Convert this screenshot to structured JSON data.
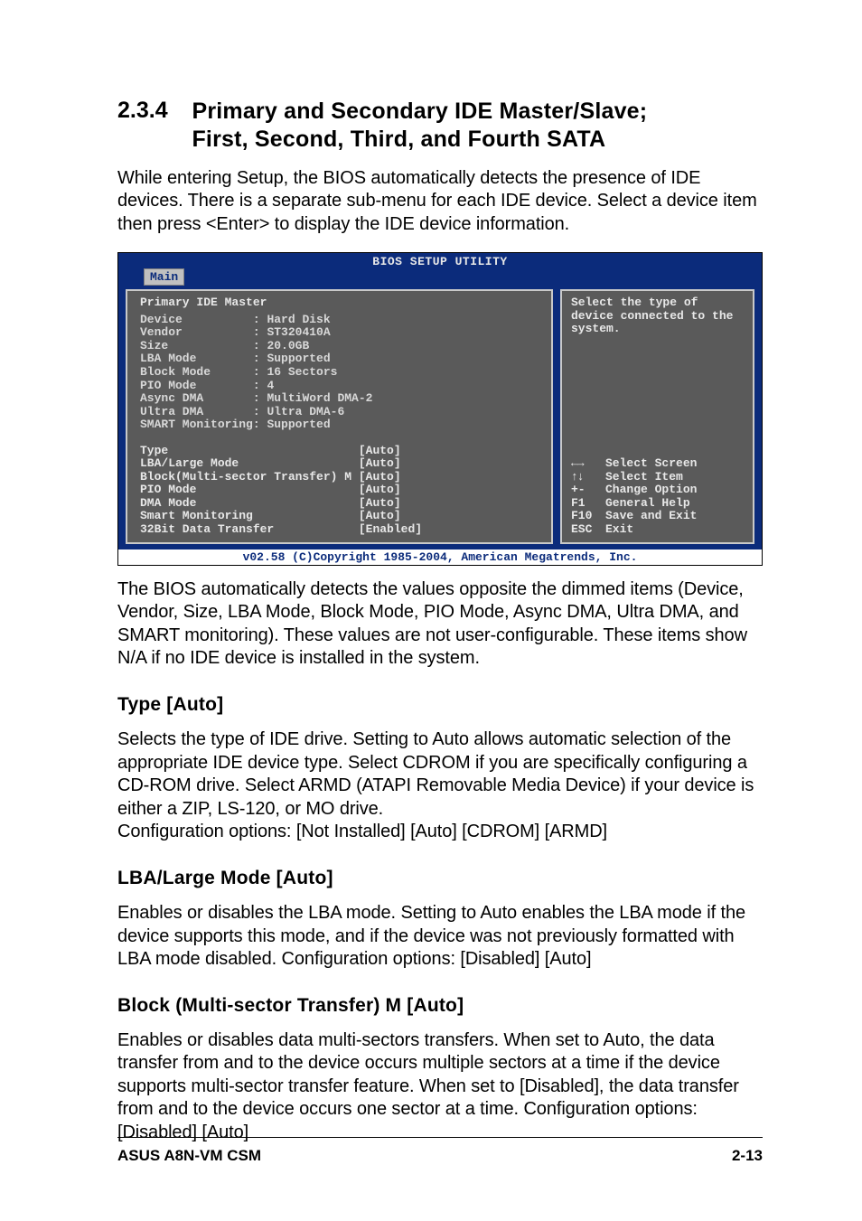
{
  "section": {
    "number": "2.3.4",
    "title_line1": "Primary and Secondary IDE Master/Slave;",
    "title_line2": "First, Second, Third, and Fourth SATA"
  },
  "intro": "While entering Setup, the BIOS automatically detects the presence of IDE devices. There is a separate sub-menu for each IDE device. Select a device item then press <Enter> to display the IDE device information.",
  "bios": {
    "header": "BIOS SETUP UTILITY",
    "tab": "Main",
    "panel_title": "Primary IDE Master",
    "info": [
      {
        "label": "Device",
        "value": "Hard Disk"
      },
      {
        "label": "Vendor",
        "value": "ST320410A"
      },
      {
        "label": "Size",
        "value": "20.0GB"
      },
      {
        "label": "LBA Mode",
        "value": "Supported"
      },
      {
        "label": "Block Mode",
        "value": "16 Sectors"
      },
      {
        "label": "PIO Mode",
        "value": "4"
      },
      {
        "label": "Async DMA",
        "value": "MultiWord DMA-2"
      },
      {
        "label": "Ultra DMA",
        "value": "Ultra DMA-6"
      },
      {
        "label": "SMART Monitoring",
        "value": "Supported"
      }
    ],
    "settings": [
      {
        "label": "Type",
        "value": "[Auto]"
      },
      {
        "label": "LBA/Large Mode",
        "value": "[Auto]"
      },
      {
        "label": "Block(Multi-sector Transfer) M",
        "value": "[Auto]"
      },
      {
        "label": "PIO Mode",
        "value": "[Auto]"
      },
      {
        "label": "DMA Mode",
        "value": "[Auto]"
      },
      {
        "label": "Smart Monitoring",
        "value": "[Auto]"
      },
      {
        "label": "32Bit Data Transfer",
        "value": "[Enabled]"
      }
    ],
    "help_text": "Select the type of device connected to the system.",
    "nav": [
      {
        "key": "←→",
        "label": "Select Screen"
      },
      {
        "key": "↑↓",
        "label": "Select Item"
      },
      {
        "key": "+-",
        "label": "Change Option"
      },
      {
        "key": "F1",
        "label": "General Help"
      },
      {
        "key": "F10",
        "label": "Save and Exit"
      },
      {
        "key": "ESC",
        "label": "Exit"
      }
    ],
    "footer": "v02.58 (C)Copyright 1985-2004, American Megatrends, Inc."
  },
  "post_bios": "The BIOS automatically detects the values opposite the dimmed items (Device, Vendor, Size, LBA Mode, Block Mode, PIO Mode, Async DMA, Ultra DMA, and SMART monitoring). These values are not user-configurable. These items show N/A if no IDE device is installed in the system.",
  "subs": [
    {
      "heading": "Type [Auto]",
      "body": "Selects the type of IDE drive. Setting to Auto allows automatic selection of the appropriate IDE device type. Select CDROM if you are specifically configuring a CD-ROM drive. Select ARMD (ATAPI Removable Media Device) if your device is either a ZIP, LS-120, or MO drive.\nConfiguration options: [Not Installed] [Auto] [CDROM] [ARMD]"
    },
    {
      "heading": "LBA/Large Mode [Auto]",
      "body": "Enables or disables the LBA mode. Setting to Auto enables the LBA mode if the device supports this mode, and if the device was not previously formatted with LBA mode disabled. Configuration options: [Disabled] [Auto]"
    },
    {
      "heading": "Block (Multi-sector Transfer) M [Auto]",
      "body": "Enables or disables data multi-sectors transfers. When set to Auto, the data transfer from and to the device occurs multiple sectors at a time if the device supports multi-sector transfer feature. When set to [Disabled], the data transfer from and to the device occurs one sector at a time. Configuration options: [Disabled] [Auto]"
    }
  ],
  "footer": {
    "left": "ASUS A8N-VM CSM",
    "right": "2-13"
  }
}
